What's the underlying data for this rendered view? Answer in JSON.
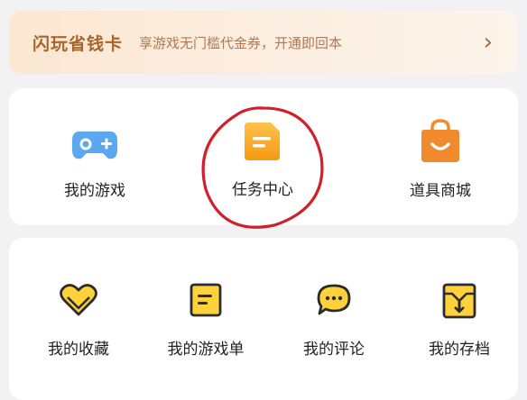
{
  "promo": {
    "title": "闪玩省钱卡",
    "description": "享游戏无门槛代金券，开通即回本",
    "arrow_icon": "chevron-right-icon"
  },
  "top_menu": [
    {
      "label": "我的游戏",
      "icon": "gamepad-icon"
    },
    {
      "label": "任务中心",
      "icon": "task-icon"
    },
    {
      "label": "道具商城",
      "icon": "shopping-bag-icon"
    }
  ],
  "bottom_menu": [
    {
      "label": "我的收藏",
      "icon": "heart-icon"
    },
    {
      "label": "我的游戏单",
      "icon": "list-icon"
    },
    {
      "label": "我的评论",
      "icon": "comment-icon"
    },
    {
      "label": "我的存档",
      "icon": "archive-icon"
    }
  ],
  "colors": {
    "accent_orange": "#f5a623",
    "game_blue": "#5aa8f0",
    "shop_orange": "#f08a2c",
    "annotation_red": "#d0202a"
  }
}
